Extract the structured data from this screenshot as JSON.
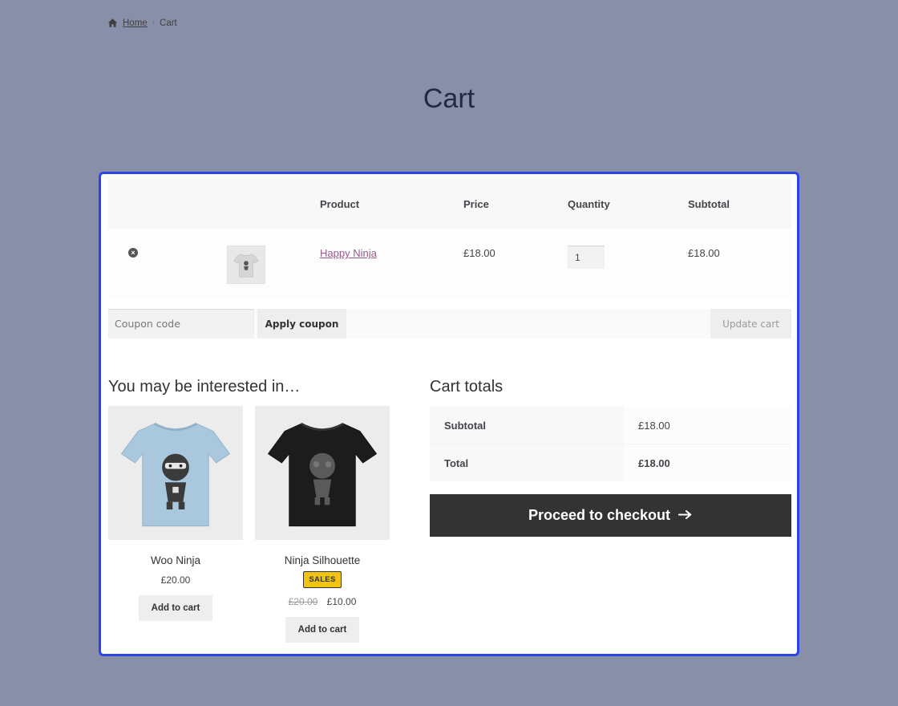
{
  "breadcrumb": {
    "home_label": "Home",
    "separator": "›",
    "current": "Cart"
  },
  "page": {
    "title": "Cart"
  },
  "cart_table": {
    "headers": {
      "product": "Product",
      "price": "Price",
      "quantity": "Quantity",
      "subtotal": "Subtotal"
    },
    "items": [
      {
        "remove_icon": "remove-x-icon",
        "name": "Happy Ninja",
        "price": "£18.00",
        "quantity": "1",
        "subtotal": "£18.00"
      }
    ]
  },
  "actions": {
    "coupon_placeholder": "Coupon code",
    "apply_label": "Apply coupon",
    "update_label": "Update cart"
  },
  "cross_sells": {
    "title": "You may be interested in…",
    "products": [
      {
        "name": "Woo Ninja",
        "price": "£20.00",
        "button": "Add to cart",
        "shirt_color": "#a9c7dd"
      },
      {
        "name": "Ninja Silhouette",
        "badge": "SALES",
        "old_price": "£20.00",
        "price": "£10.00",
        "button": "Add to cart",
        "shirt_color": "#1c1c1c"
      }
    ]
  },
  "totals": {
    "title": "Cart totals",
    "subtotal_label": "Subtotal",
    "subtotal_value": "£18.00",
    "total_label": "Total",
    "total_value": "£18.00",
    "checkout_label": "Proceed to checkout",
    "checkout_icon": "arrow-right-icon"
  },
  "colors": {
    "page_bg": "#888fa8",
    "panel_border": "#2b44e8",
    "link": "#96588a",
    "checkout_bg": "#333333",
    "sale_badge": "#f1c40f"
  }
}
